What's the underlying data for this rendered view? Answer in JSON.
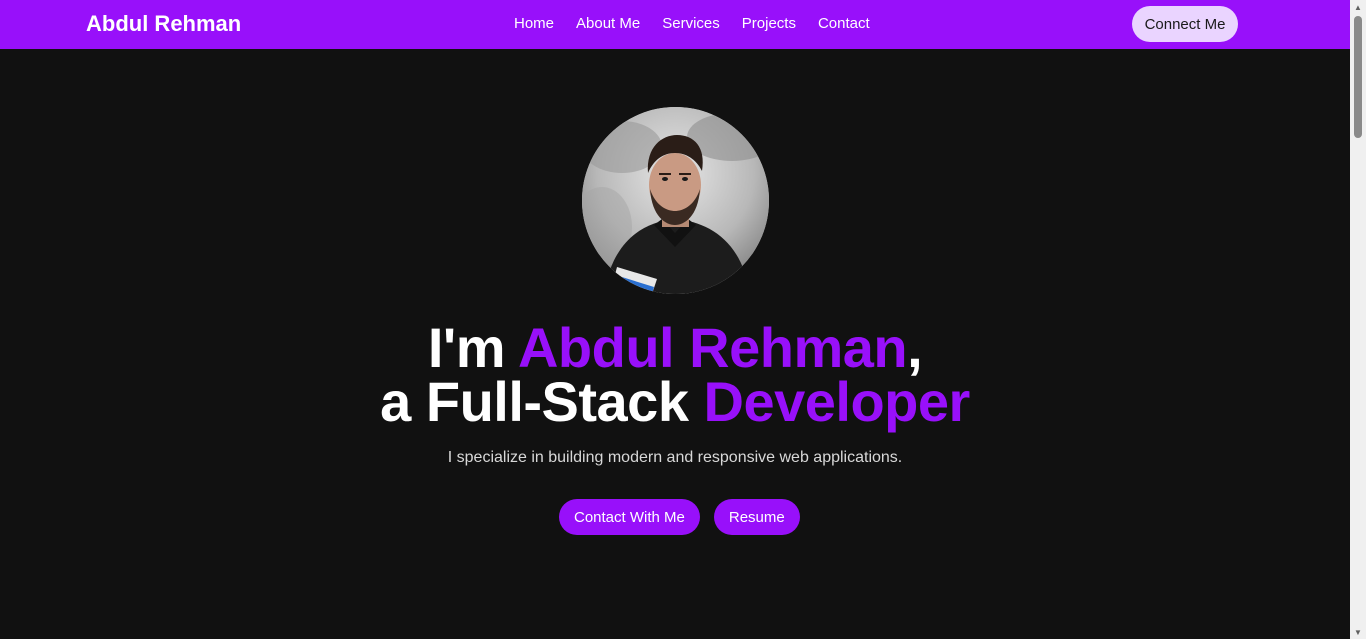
{
  "navbar": {
    "brand": "Abdul Rehman",
    "links": [
      {
        "label": "Home"
      },
      {
        "label": "About Me"
      },
      {
        "label": "Services"
      },
      {
        "label": "Projects"
      },
      {
        "label": "Contact"
      }
    ],
    "cta_label": "Connect Me"
  },
  "hero": {
    "avatar_icon": "profile-photo",
    "line1": {
      "prefix": "I'm ",
      "name": "Abdul Rehman",
      "suffix": ","
    },
    "line2": {
      "prefix": "a Full-Stack ",
      "role": "Developer"
    },
    "subtitle": "I specialize in building modern and responsive web applications.",
    "buttons": {
      "contact": "Contact With Me",
      "resume": "Resume"
    }
  },
  "scrollbar": {
    "up_icon": "▲",
    "down_icon": "▼"
  },
  "colors": {
    "accent": "#9810fa",
    "background": "#111111",
    "connect_button_bg": "#ead4ff",
    "text": "#ffffff"
  }
}
